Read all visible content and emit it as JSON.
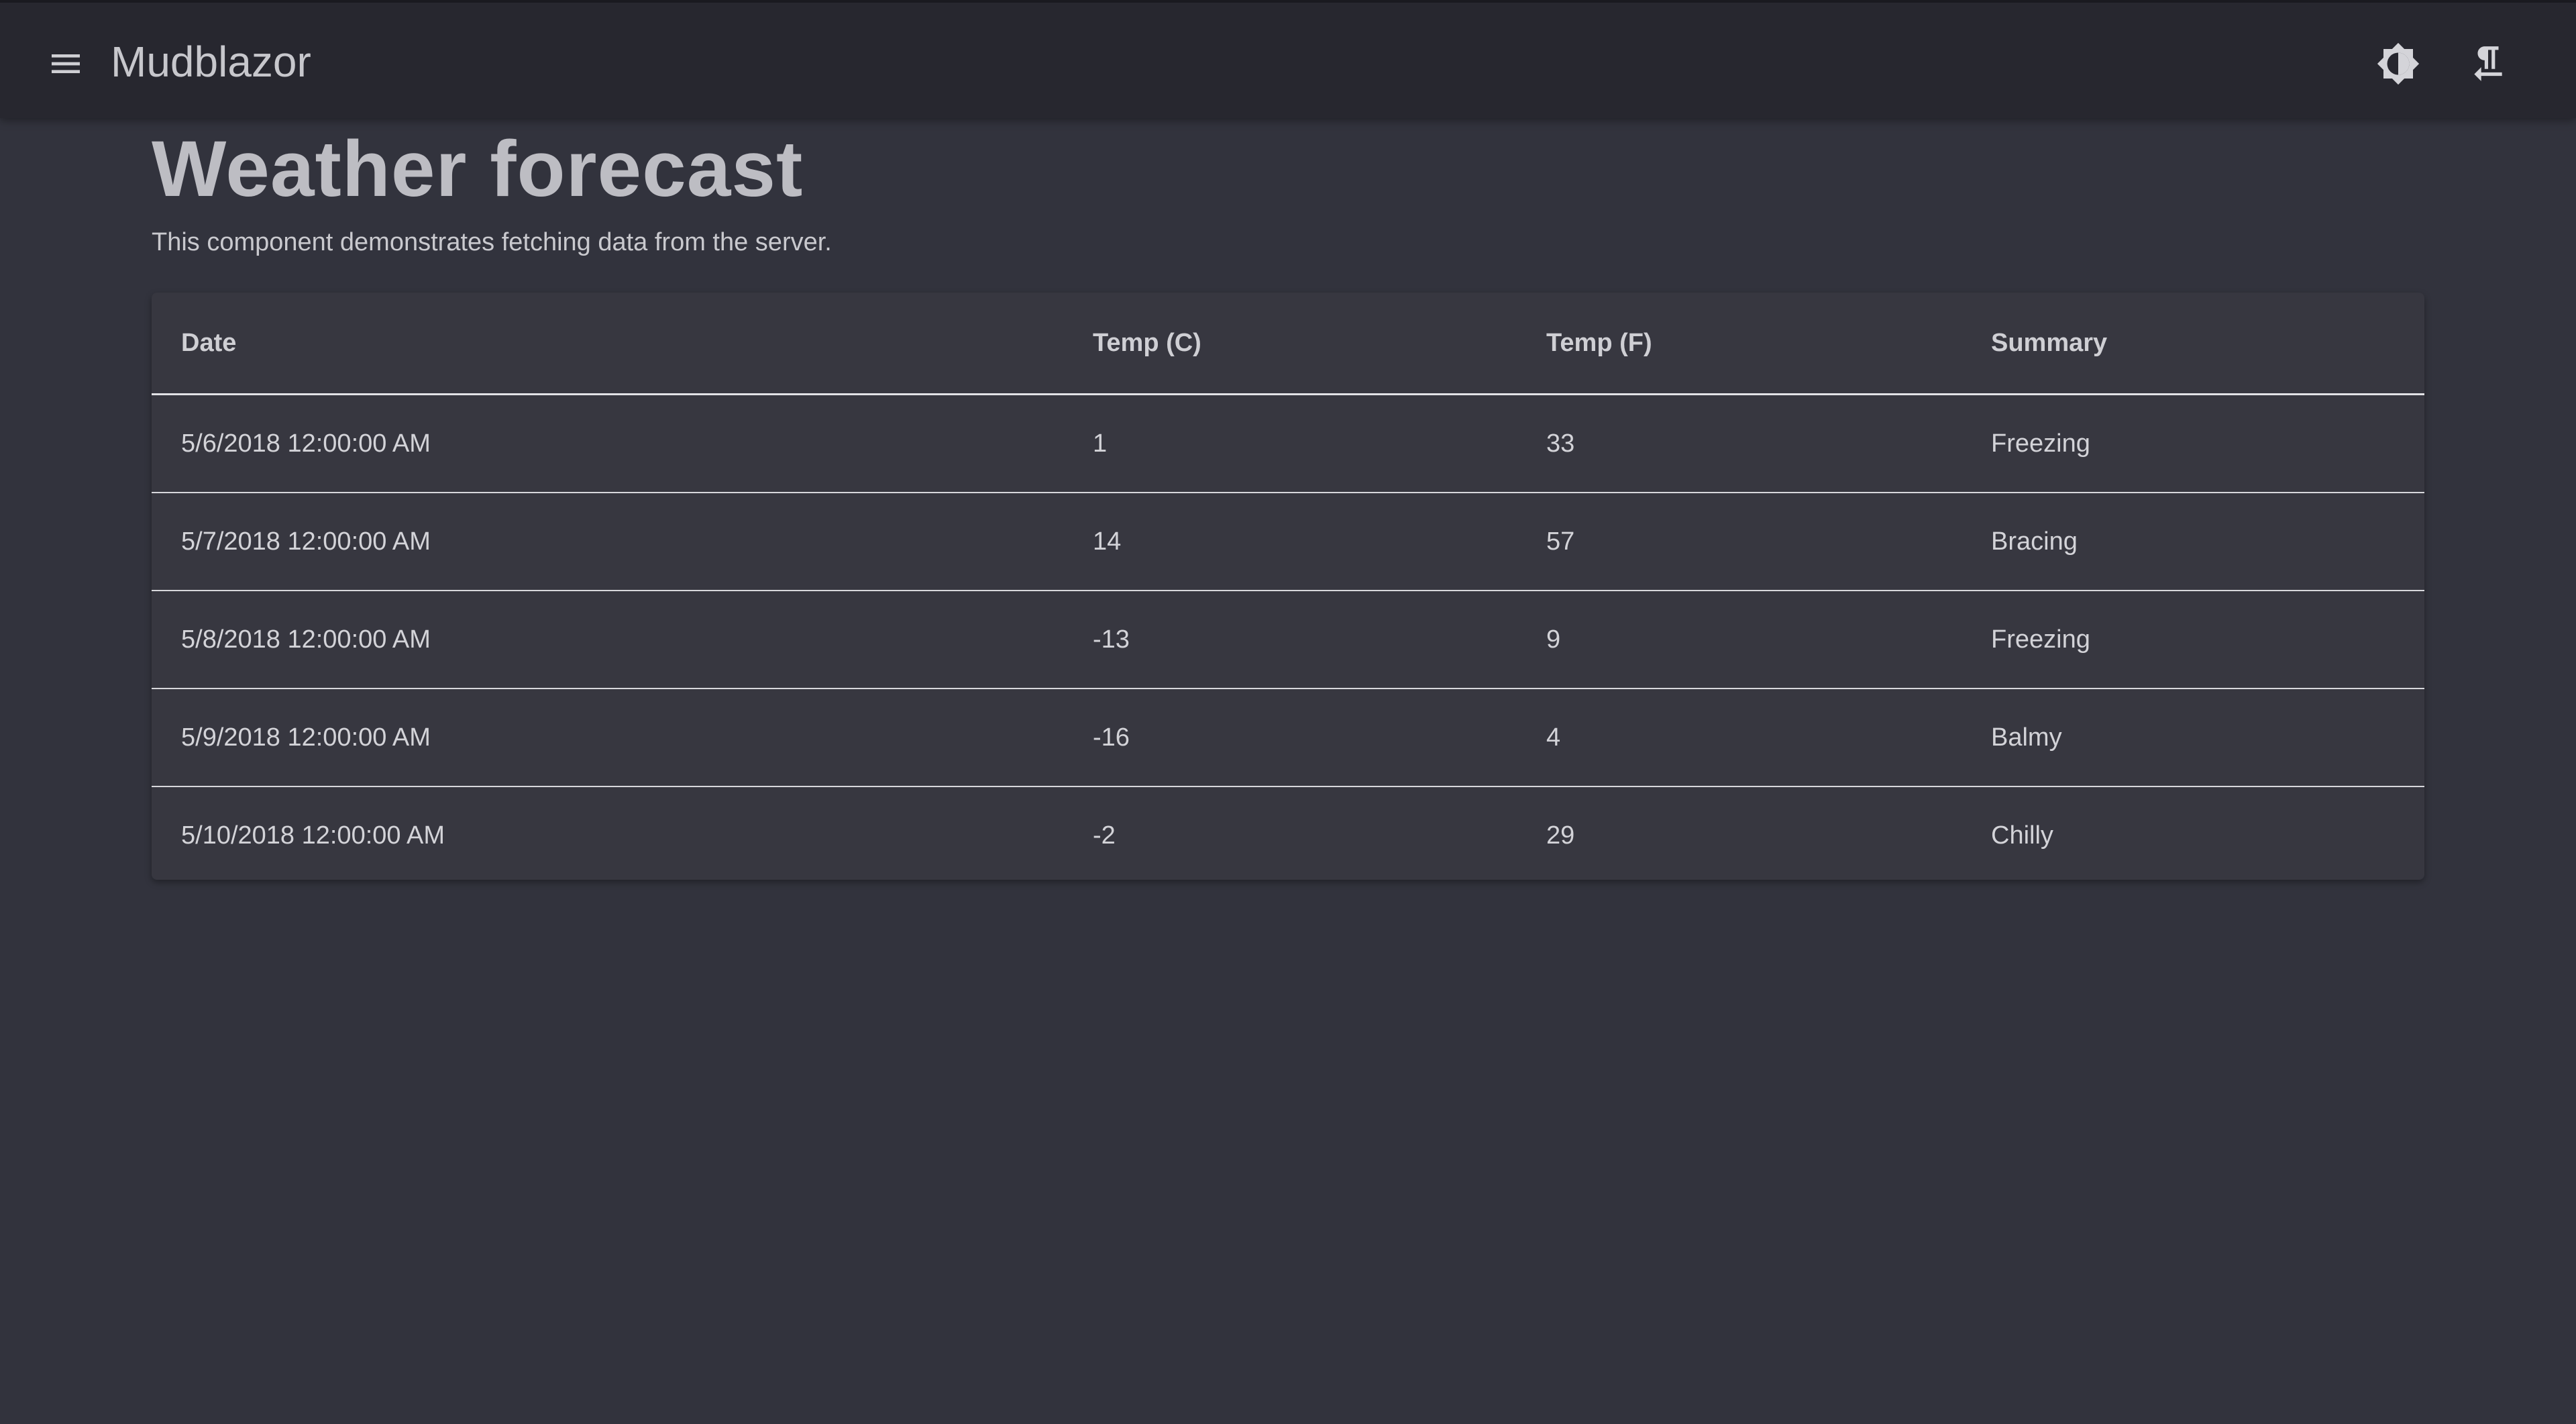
{
  "app": {
    "title": "Mudblazor"
  },
  "icons": {
    "menu": "menu-icon",
    "theme": "brightness-icon",
    "rtl": "paragraph-rtl-icon"
  },
  "page": {
    "title": "Weather forecast",
    "description": "This component demonstrates fetching data from the server."
  },
  "table": {
    "headers": [
      "Date",
      "Temp (C)",
      "Temp (F)",
      "Summary"
    ],
    "rows": [
      [
        "5/6/2018 12:00:00 AM",
        "1",
        "33",
        "Freezing"
      ],
      [
        "5/7/2018 12:00:00 AM",
        "14",
        "57",
        "Bracing"
      ],
      [
        "5/8/2018 12:00:00 AM",
        "-13",
        "9",
        "Freezing"
      ],
      [
        "5/9/2018 12:00:00 AM",
        "-16",
        "4",
        "Balmy"
      ],
      [
        "5/10/2018 12:00:00 AM",
        "-2",
        "29",
        "Chilly"
      ]
    ]
  },
  "colors": {
    "background": "#32333d",
    "appbar": "#27272f",
    "surface": "#373740",
    "text": "#d6d6db"
  }
}
